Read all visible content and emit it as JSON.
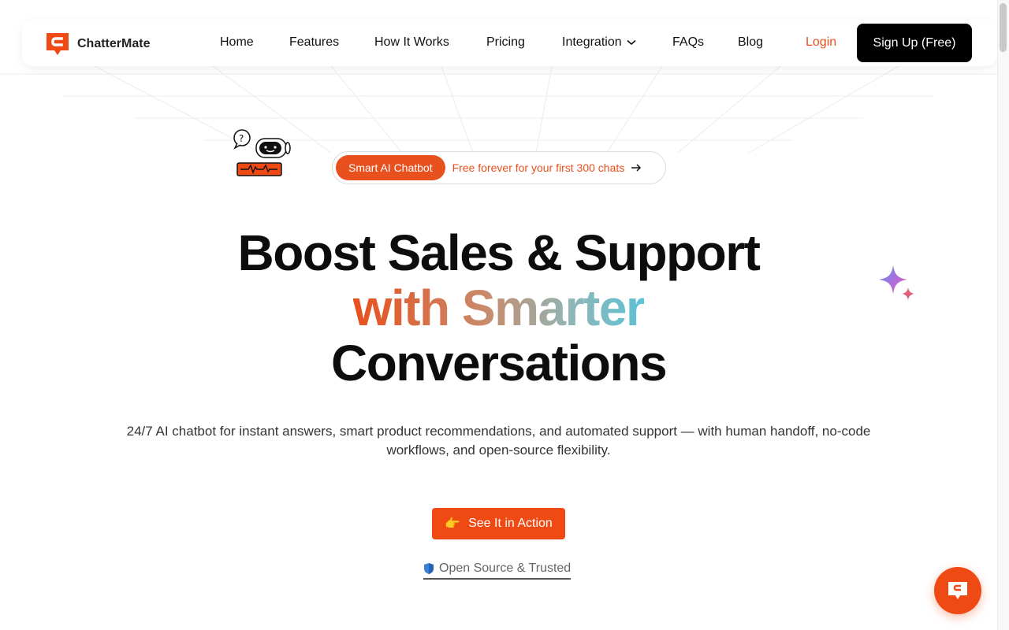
{
  "brand": {
    "name": "ChatterMate",
    "accent": "#e8501e",
    "cta_color": "#f04a14"
  },
  "nav": {
    "items": [
      {
        "label": "Home"
      },
      {
        "label": "Features"
      },
      {
        "label": "How It Works"
      },
      {
        "label": "Pricing"
      },
      {
        "label": "Integration",
        "icon": "chevron-down-icon"
      },
      {
        "label": "FAQs"
      },
      {
        "label": "Blog"
      }
    ],
    "login": "Login",
    "signup": "Sign Up (Free)"
  },
  "announcement": {
    "tag": "Smart AI Chatbot",
    "text": "Free forever for your first 300 chats",
    "icon": "arrow-right-icon"
  },
  "hero": {
    "line1": "Boost Sales & Support",
    "line2": "with Smarter",
    "line3": "Conversations",
    "subtitle": "24/7 AI chatbot for instant answers, smart product recommendations, and automated support — with human handoff, no-code workflows, and open-source flexibility.",
    "cta_icon": "👉",
    "cta_label": "See It in Action",
    "trust_icon": "shield-icon",
    "trust_label": "Open Source & Trusted"
  },
  "widget": {
    "icon": "chat-bubble-icon"
  }
}
